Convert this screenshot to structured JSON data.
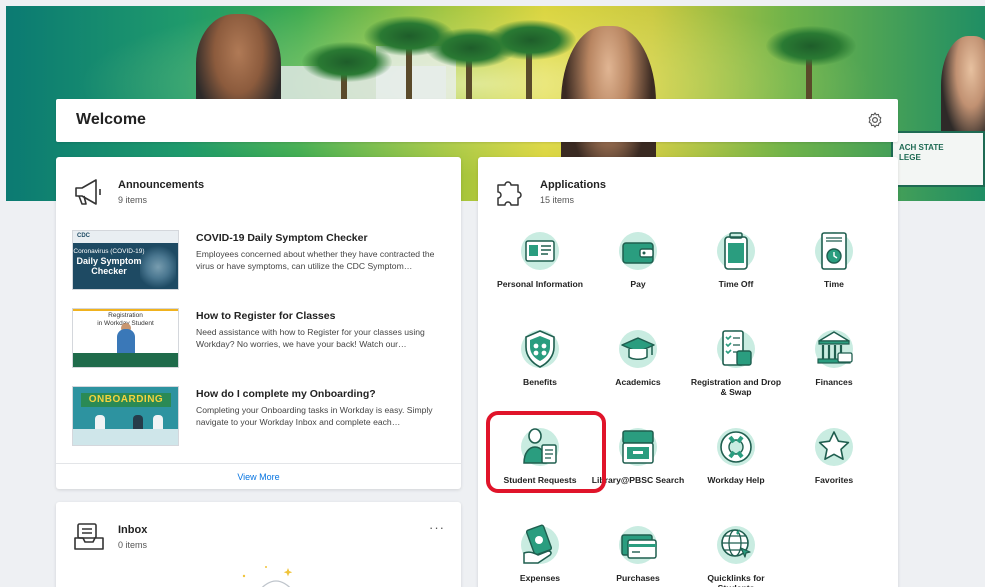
{
  "welcome": {
    "title": "Welcome"
  },
  "hero": {
    "pennant_text": "ACH STATE\nLEGE"
  },
  "announcements": {
    "title": "Announcements",
    "count": "9 items",
    "items": [
      {
        "title": "COVID-19 Daily Symptom Checker",
        "desc": "Employees concerned about whether they have contracted the virus or have symptoms, can utilize the CDC Symptom…",
        "thumb_logo": "CDC",
        "thumb_text1": "Coronavirus (COVID-19)",
        "thumb_text2": "Daily Symptom Checker"
      },
      {
        "title": "How to Register for Classes",
        "desc": "Need assistance with how to Register for your classes using Workday? No worries, we have your back! Watch our…",
        "thumb_text1": "Registration",
        "thumb_text2": "in Workday Student"
      },
      {
        "title": "How do I complete my Onboarding?",
        "desc": "Completing your Onboarding tasks in Workday is easy. Simply navigate to your Workday Inbox and complete each…",
        "thumb_text1": "ONBOARDING"
      }
    ],
    "view_more": "View More"
  },
  "inbox": {
    "title": "Inbox",
    "count": "0 items",
    "more": "···"
  },
  "applications": {
    "title": "Applications",
    "count": "15 items",
    "apps": [
      {
        "label": "Personal Information",
        "icon": "id-card-icon"
      },
      {
        "label": "Pay",
        "icon": "wallet-icon"
      },
      {
        "label": "Time Off",
        "icon": "suitcase-icon"
      },
      {
        "label": "Time",
        "icon": "time-clock-icon"
      },
      {
        "label": "Benefits",
        "icon": "shield-icon"
      },
      {
        "label": "Academics",
        "icon": "graduation-cap-icon"
      },
      {
        "label": "Registration and Drop & Swap",
        "icon": "checklist-icon"
      },
      {
        "label": "Finances",
        "icon": "bank-icon"
      },
      {
        "label": "Student Requests",
        "icon": "student-clipboard-icon"
      },
      {
        "label": "Library@PBSC Search",
        "icon": "file-drawer-icon"
      },
      {
        "label": "Workday Help",
        "icon": "lifebuoy-icon"
      },
      {
        "label": "Favorites",
        "icon": "star-icon"
      },
      {
        "label": "Expenses",
        "icon": "money-hand-icon"
      },
      {
        "label": "Purchases",
        "icon": "credit-card-icon"
      },
      {
        "label": "Quicklinks for Students",
        "icon": "globe-cursor-icon"
      }
    ]
  },
  "colors": {
    "accent": "#0875e1",
    "icon_teal": "#2a9d7f",
    "icon_light": "#c9ece1",
    "highlight": "#e0142a"
  }
}
